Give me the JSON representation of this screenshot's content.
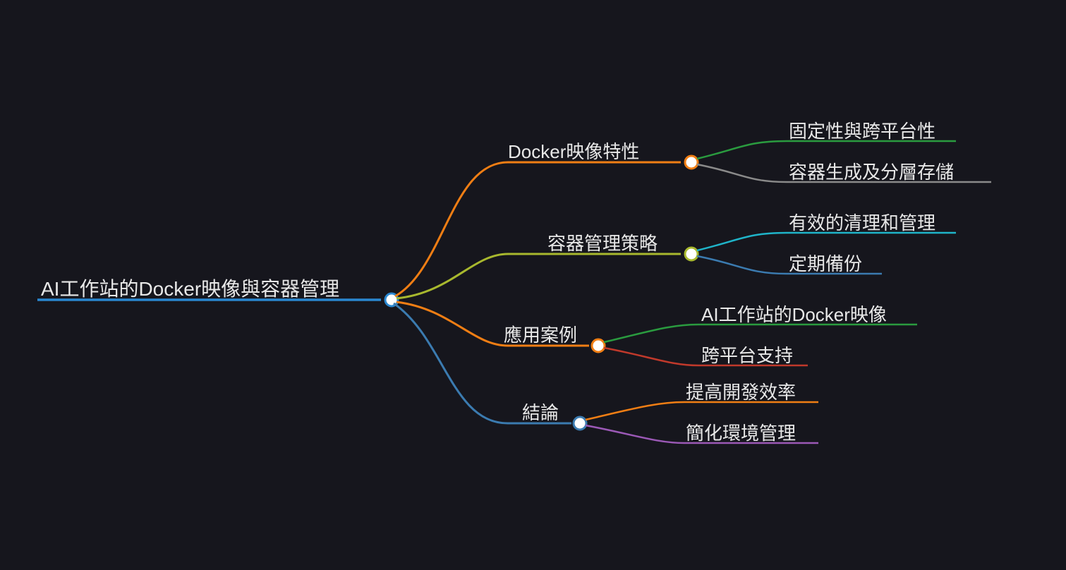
{
  "colors": {
    "blue": "#2a87d0",
    "orange": "#f07e14",
    "olive": "#a8b82e",
    "steel": "#3b7bb0",
    "green": "#2a9b3f",
    "gray": "#8a8a8a",
    "cyan": "#1fb4c9",
    "steelblue": "#3b7bb0",
    "red": "#c0392b",
    "purple": "#9b59b6",
    "white": "#ffffff"
  },
  "root": {
    "label": "AI工作站的Docker映像與容器管理"
  },
  "branches": [
    {
      "label": "Docker映像特性",
      "children": [
        {
          "label": "固定性與跨平台性"
        },
        {
          "label": "容器生成及分層存儲"
        }
      ]
    },
    {
      "label": "容器管理策略",
      "children": [
        {
          "label": "有效的清理和管理"
        },
        {
          "label": "定期備份"
        }
      ]
    },
    {
      "label": "應用案例",
      "children": [
        {
          "label": "AI工作站的Docker映像"
        },
        {
          "label": "跨平台支持"
        }
      ]
    },
    {
      "label": "結論",
      "children": [
        {
          "label": "提高開發效率"
        },
        {
          "label": "簡化環境管理"
        }
      ]
    }
  ]
}
